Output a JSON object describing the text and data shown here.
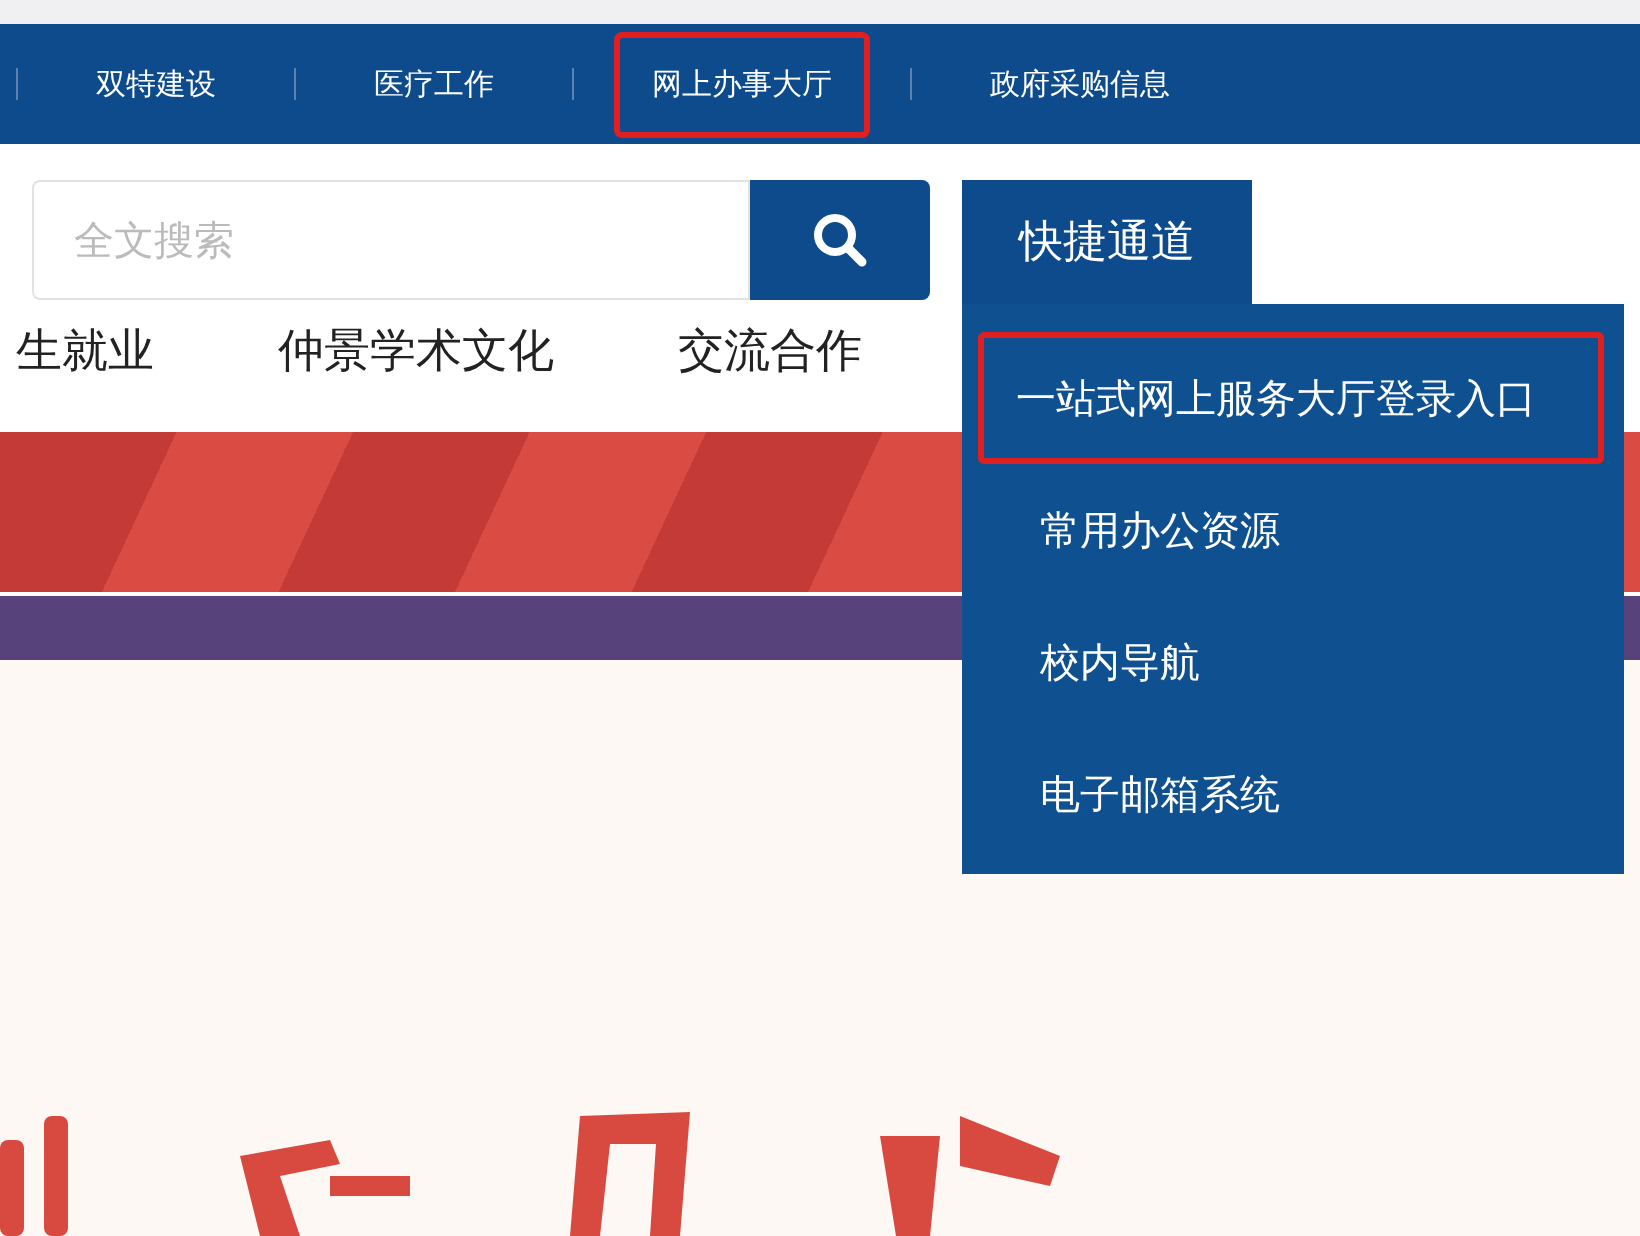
{
  "top_nav": {
    "items": [
      {
        "label": "双特建设",
        "highlighted": false
      },
      {
        "label": "医疗工作",
        "highlighted": false
      },
      {
        "label": "网上办事大厅",
        "highlighted": true
      },
      {
        "label": "政府采购信息",
        "highlighted": false
      }
    ]
  },
  "search": {
    "placeholder": "全文搜索"
  },
  "quick_access": {
    "label": "快捷通道",
    "expanded": true,
    "items": [
      {
        "label": "一站式网上服务大厅登录入口",
        "highlighted": true
      },
      {
        "label": "常用办公资源",
        "highlighted": false
      },
      {
        "label": "校内导航",
        "highlighted": false
      },
      {
        "label": "电子邮箱系统",
        "highlighted": false
      }
    ]
  },
  "main_nav": {
    "items": [
      "生就业",
      "仲景学术文化",
      "交流合作"
    ]
  }
}
